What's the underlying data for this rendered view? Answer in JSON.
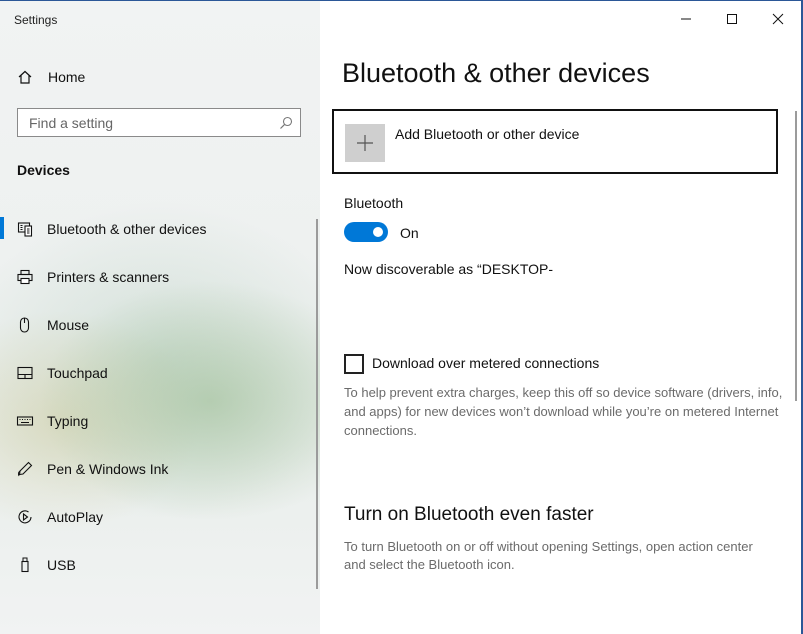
{
  "window": {
    "title": "Settings",
    "controls": {
      "minimize": "minimize-icon",
      "maximize": "maximize-icon",
      "close": "close-icon"
    }
  },
  "sidebar": {
    "home_label": "Home",
    "search_placeholder": "Find a setting",
    "section_title": "Devices",
    "items": [
      {
        "label": "Bluetooth & other devices",
        "icon": "bluetooth-devices-icon",
        "selected": true
      },
      {
        "label": "Printers & scanners",
        "icon": "printer-icon"
      },
      {
        "label": "Mouse",
        "icon": "mouse-icon"
      },
      {
        "label": "Touchpad",
        "icon": "touchpad-icon"
      },
      {
        "label": "Typing",
        "icon": "keyboard-icon"
      },
      {
        "label": "Pen & Windows Ink",
        "icon": "pen-icon"
      },
      {
        "label": "AutoPlay",
        "icon": "autoplay-icon"
      },
      {
        "label": "USB",
        "icon": "usb-icon"
      }
    ]
  },
  "main": {
    "title": "Bluetooth & other devices",
    "add_device_label": "Add Bluetooth or other device",
    "bluetooth_label": "Bluetooth",
    "bluetooth_state": "On",
    "bluetooth_on": true,
    "discoverable_text": "Now discoverable as “DESKTOP-",
    "metered_label": "Download over metered connections",
    "metered_checked": false,
    "metered_help": "To help prevent extra charges, keep this off so device software (drivers, info, and apps) for new devices won’t download while you’re on metered Internet connections.",
    "faster_heading": "Turn on Bluetooth even faster",
    "faster_help": "To turn Bluetooth on or off without opening Settings, open action center and select the Bluetooth icon."
  },
  "colors": {
    "accent": "#0078d7",
    "secondary_text": "#6b6b6b"
  }
}
